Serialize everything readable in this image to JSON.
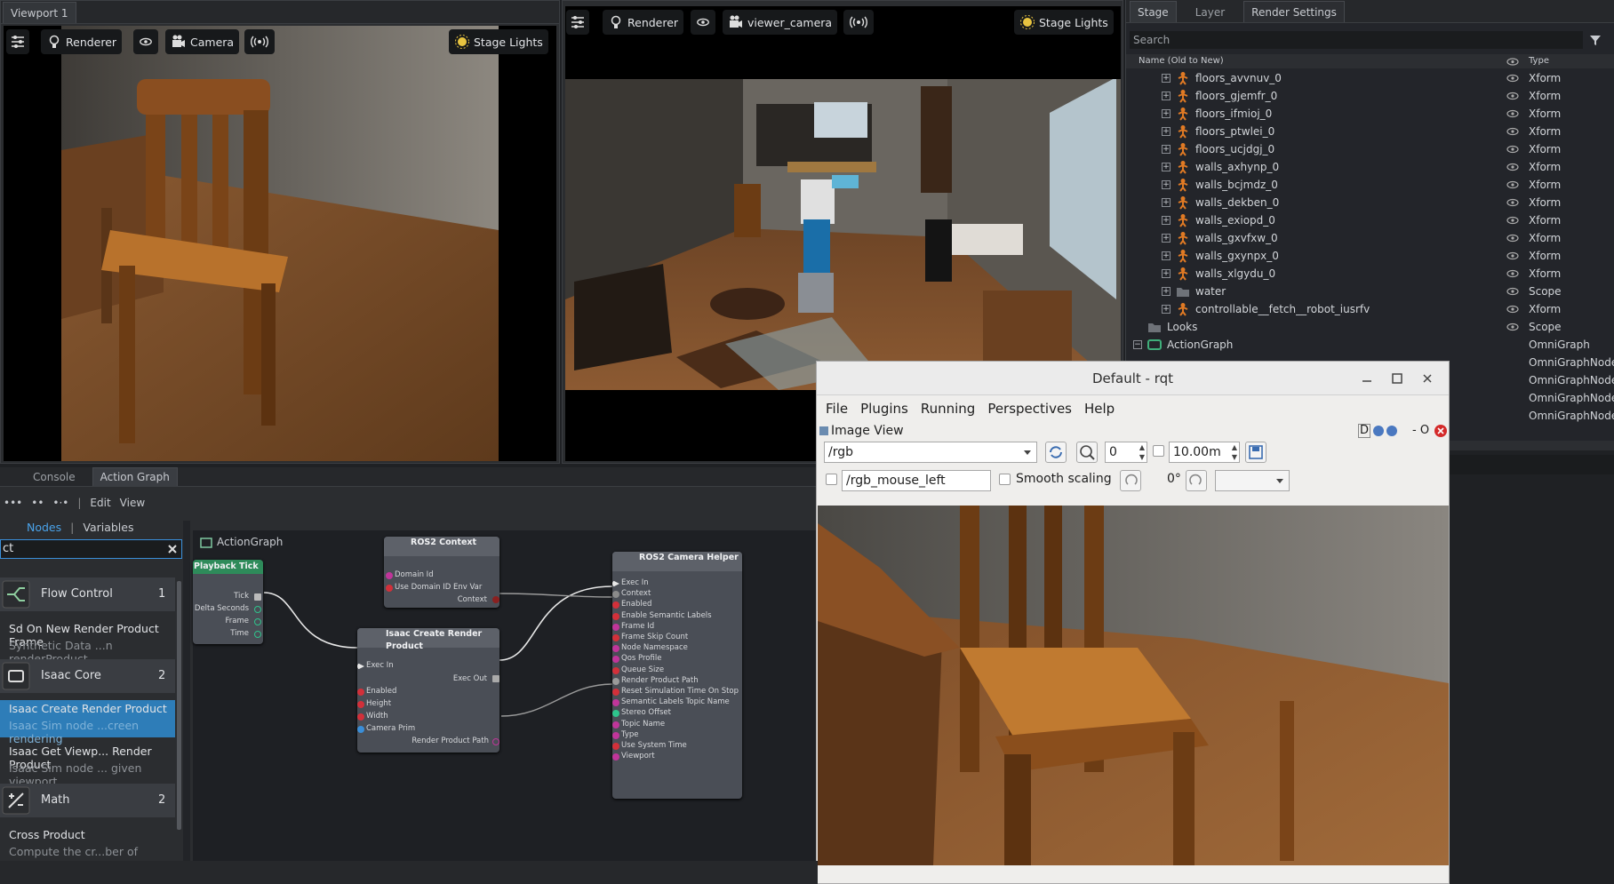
{
  "viewport1": {
    "tab": "Viewport 1",
    "renderer_label": "Renderer",
    "camera_label": "Camera",
    "stage_lights_label": "Stage Lights"
  },
  "viewport2": {
    "renderer_label": "Renderer",
    "camera_label": "viewer_camera",
    "stage_lights_label": "Stage Lights"
  },
  "stage": {
    "tabs": [
      "Stage",
      "Layer",
      "Render Settings"
    ],
    "search_placeholder": "Search",
    "col_name": "Name (Old to New)",
    "col_type": "Type",
    "rows": [
      {
        "name": "floors_avvnuv_0",
        "type": "Xform"
      },
      {
        "name": "floors_gjemfr_0",
        "type": "Xform"
      },
      {
        "name": "floors_ifmioj_0",
        "type": "Xform"
      },
      {
        "name": "floors_ptwlei_0",
        "type": "Xform"
      },
      {
        "name": "floors_ucjdgj_0",
        "type": "Xform"
      },
      {
        "name": "walls_axhynp_0",
        "type": "Xform"
      },
      {
        "name": "walls_bcjmdz_0",
        "type": "Xform"
      },
      {
        "name": "walls_dekben_0",
        "type": "Xform"
      },
      {
        "name": "walls_exiopd_0",
        "type": "Xform"
      },
      {
        "name": "walls_gxvfxw_0",
        "type": "Xform"
      },
      {
        "name": "walls_gxynpx_0",
        "type": "Xform"
      },
      {
        "name": "walls_xlgydu_0",
        "type": "Xform"
      },
      {
        "name": "water",
        "type": "Scope"
      },
      {
        "name": "controllable__fetch__robot_iusrfv",
        "type": "Xform"
      },
      {
        "name": "Looks",
        "type": "Scope"
      },
      {
        "name": "ActionGraph",
        "type": "OmniGraph"
      }
    ],
    "extra_types": [
      "OmniGraphNode",
      "OmniGraphNode",
      "OmniGraphNode",
      "OmniGraphNode"
    ]
  },
  "bottom_panel": {
    "tabs": [
      "Console",
      "Action Graph"
    ],
    "toolbar": {
      "edit": "Edit",
      "view": "View"
    },
    "nodes_label": "Nodes",
    "variables_label": "Variables",
    "search_value": "ct",
    "list": {
      "flow_control": {
        "label": "Flow Control",
        "count": "1"
      },
      "sd_item": {
        "title": "Sd On New Render Product Frame",
        "sub": "Synthetic Data ...n renderProduct"
      },
      "isaac_core": {
        "label": "Isaac Core",
        "count": "2"
      },
      "create_rp": {
        "title": "Isaac Create Render Product",
        "sub": "Isaac Sim node ...creen rendering"
      },
      "get_viewport": {
        "title": "Isaac Get Viewp... Render Product",
        "sub": "Isaac Sim node ... given viewport"
      },
      "math": {
        "label": "Math",
        "count": "2"
      },
      "cross": {
        "title": "Cross Product",
        "sub": "Compute the cr...ber of elements"
      }
    },
    "graph_title": "ActionGraph",
    "nodes": {
      "playback": {
        "title": "Playback Tick",
        "ports": [
          "Tick",
          "Delta Seconds",
          "Frame",
          "Time"
        ]
      },
      "ros2ctx": {
        "title": "ROS2 Context",
        "ports": [
          "Domain Id",
          "Use Domain ID Env Var",
          "Context"
        ]
      },
      "createrp": {
        "title": "Isaac Create Render Product",
        "ports": [
          "Exec In",
          "Exec Out",
          "Enabled",
          "Height",
          "Width",
          "Camera Prim",
          "Render Product Path"
        ]
      },
      "camhelper": {
        "title": "ROS2 Camera Helper",
        "ports": [
          "Exec In",
          "Context",
          "Enabled",
          "Enable Semantic Labels",
          "Frame Id",
          "Frame Skip Count",
          "Node Namespace",
          "Qos Profile",
          "Queue Size",
          "Render Product Path",
          "Reset Simulation Time On Stop",
          "Semantic Labels Topic Name",
          "Stereo Offset",
          "Topic Name",
          "Type",
          "Use System Time",
          "Viewport"
        ]
      }
    }
  },
  "rqt": {
    "title": "Default - rqt",
    "menu": [
      "File",
      "Plugins",
      "Running",
      "Perspectives",
      "Help"
    ],
    "plugin_title": "Image View",
    "plugin_controls": "D",
    "plugin_dash": "- O",
    "topic": "/rgb",
    "spin_value": "0",
    "spin_time": "10.00m",
    "mouse_topic": "/rgb_mouse_left",
    "smooth_scaling": "Smooth scaling",
    "rotation": "0°"
  },
  "colors": {
    "bg": "#1f2124",
    "panel": "#2b2d30",
    "accent_blue": "#2e7db8",
    "playback_green": "#2e8b5a",
    "exec_port": "#e8e8e8",
    "port_red": "#d2303a",
    "port_magenta": "#c0359a",
    "port_blue": "#3a8ed8",
    "port_teal": "#2ec48c"
  }
}
